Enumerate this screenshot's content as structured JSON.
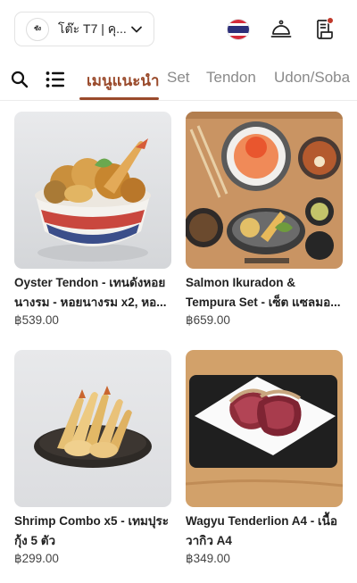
{
  "header": {
    "logo_text": "ซัง",
    "table_label": "โต๊ะ T7 | คุ...",
    "language": "Thai"
  },
  "tabs": [
    {
      "label": "เมนูแนะนำ",
      "active": true
    },
    {
      "label": "Set",
      "active": false
    },
    {
      "label": "Tendon",
      "active": false
    },
    {
      "label": "Udon/Soba",
      "active": false
    }
  ],
  "colors": {
    "accent": "#9a4a2b",
    "notification": "#c0392b"
  },
  "products": [
    {
      "name": "Oyster Tendon - เทนดังหอยนางรม - หอยนางรม x2, หอ...",
      "price": "฿539.00"
    },
    {
      "name": "Salmon Ikuradon & Tempura Set - เซ็ต แซลมอ...",
      "price": "฿659.00"
    },
    {
      "name": "Shrimp Combo x5 - เทมปุระกุ้ง 5 ตัว",
      "price": "฿299.00"
    },
    {
      "name": "Wagyu Tenderlion A4 - เนื้อวากิว A4",
      "price": "฿349.00"
    }
  ]
}
